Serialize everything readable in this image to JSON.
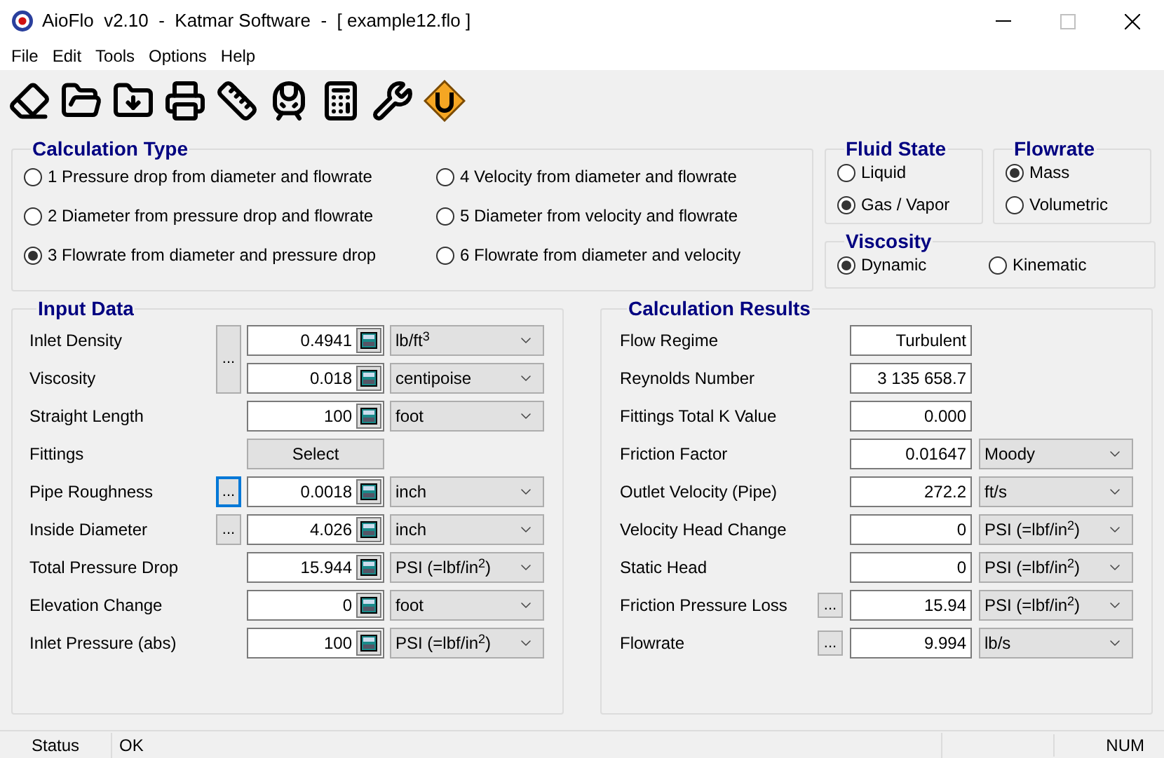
{
  "window": {
    "title": "AioFlo  v2.10  -  Katmar Software  -  [ example12.flo ]",
    "controls": [
      {
        "kind": "minimize",
        "disabled": false
      },
      {
        "kind": "maximize",
        "disabled": true
      },
      {
        "kind": "close",
        "disabled": false
      }
    ]
  },
  "menu": [
    "File",
    "Edit",
    "Tools",
    "Options",
    "Help"
  ],
  "toolbar": [
    {
      "kind": "eraser"
    },
    {
      "kind": "folder"
    },
    {
      "kind": "folder-down"
    },
    {
      "kind": "printer"
    },
    {
      "kind": "ruler"
    },
    {
      "kind": "train"
    },
    {
      "kind": "calculator"
    },
    {
      "kind": "tools"
    },
    {
      "kind": "badge"
    }
  ],
  "calculation_type": {
    "title": "Calculation Type",
    "options": [
      {
        "label": "1 Pressure drop from diameter and flowrate",
        "selected": false
      },
      {
        "label": "2 Diameter from pressure drop and flowrate",
        "selected": false
      },
      {
        "label": "3 Flowrate from diameter and pressure drop",
        "selected": true
      },
      {
        "label": "4 Velocity from diameter and flowrate",
        "selected": false
      },
      {
        "label": "5 Diameter from velocity and flowrate",
        "selected": false
      },
      {
        "label": "6 Flowrate from diameter and velocity",
        "selected": false
      }
    ]
  },
  "fluid_state": {
    "title": "Fluid State",
    "options": [
      {
        "label": "Liquid",
        "selected": false
      },
      {
        "label": "Gas / Vapor",
        "selected": true
      }
    ]
  },
  "flowrate": {
    "title": "Flowrate",
    "options": [
      {
        "label": "Mass",
        "selected": true
      },
      {
        "label": "Volumetric",
        "selected": false
      }
    ]
  },
  "viscosity": {
    "title": "Viscosity",
    "options": [
      {
        "label": "Dynamic",
        "selected": true
      },
      {
        "label": "Kinematic",
        "selected": false
      }
    ]
  },
  "input_data": {
    "title": "Input Data",
    "rows": [
      {
        "label": "Inlet Density",
        "kind": "value",
        "more": {
          "label": "...",
          "kind": "shared",
          "focused": false
        },
        "value": "0.4941",
        "unit": "lb/ft$^{3}$"
      },
      {
        "label": "Viscosity",
        "kind": "value",
        "value": "0.018",
        "unit": "centipoise"
      },
      {
        "label": "Straight Length",
        "kind": "value",
        "value": "100",
        "unit": "foot"
      },
      {
        "label": "Fittings",
        "kind": "button",
        "button": "Select"
      },
      {
        "label": "Pipe Roughness",
        "kind": "value",
        "more": {
          "label": "...",
          "kind": "single",
          "focused": true
        },
        "value": "0.0018",
        "unit": "inch"
      },
      {
        "label": "Inside Diameter",
        "kind": "value",
        "more": {
          "label": "...",
          "kind": "single",
          "focused": false
        },
        "value": "4.026",
        "unit": "inch"
      },
      {
        "label": "Total Pressure Drop",
        "kind": "value",
        "value": "15.944",
        "unit": "PSI (=lbf/in$^{2}$)"
      },
      {
        "label": "Elevation Change",
        "kind": "value",
        "value": "0",
        "unit": "foot"
      },
      {
        "label": "Inlet Pressure (abs)",
        "kind": "value",
        "value": "100",
        "unit": "PSI (=lbf/in$^{2}$)"
      }
    ]
  },
  "calculation_results": {
    "title": "Calculation Results",
    "rows": [
      {
        "label": "Flow Regime",
        "value": "Turbulent"
      },
      {
        "label": "Reynolds Number",
        "value": "3 135 658.7"
      },
      {
        "label": "Fittings Total K Value",
        "value": "0.000"
      },
      {
        "label": "Friction Factor",
        "value": "0.01647",
        "unit": "Moody"
      },
      {
        "label": "Outlet Velocity (Pipe)",
        "value": "272.2",
        "unit": "ft/s"
      },
      {
        "label": "Velocity Head Change",
        "value": "0",
        "unit": "PSI (=lbf/in$^{2}$)"
      },
      {
        "label": "Static Head",
        "value": "0",
        "unit": "PSI (=lbf/in$^{2}$)"
      },
      {
        "label": "Friction Pressure Loss",
        "more": {
          "label": "..."
        },
        "value": "15.94",
        "unit": "PSI (=lbf/in$^{2}$)"
      },
      {
        "label": "Flowrate",
        "more": {
          "label": "..."
        },
        "value": "9.994",
        "unit": "lb/s"
      }
    ]
  },
  "status_bar": {
    "label": "Status",
    "message": "OK",
    "indicator": "NUM"
  }
}
